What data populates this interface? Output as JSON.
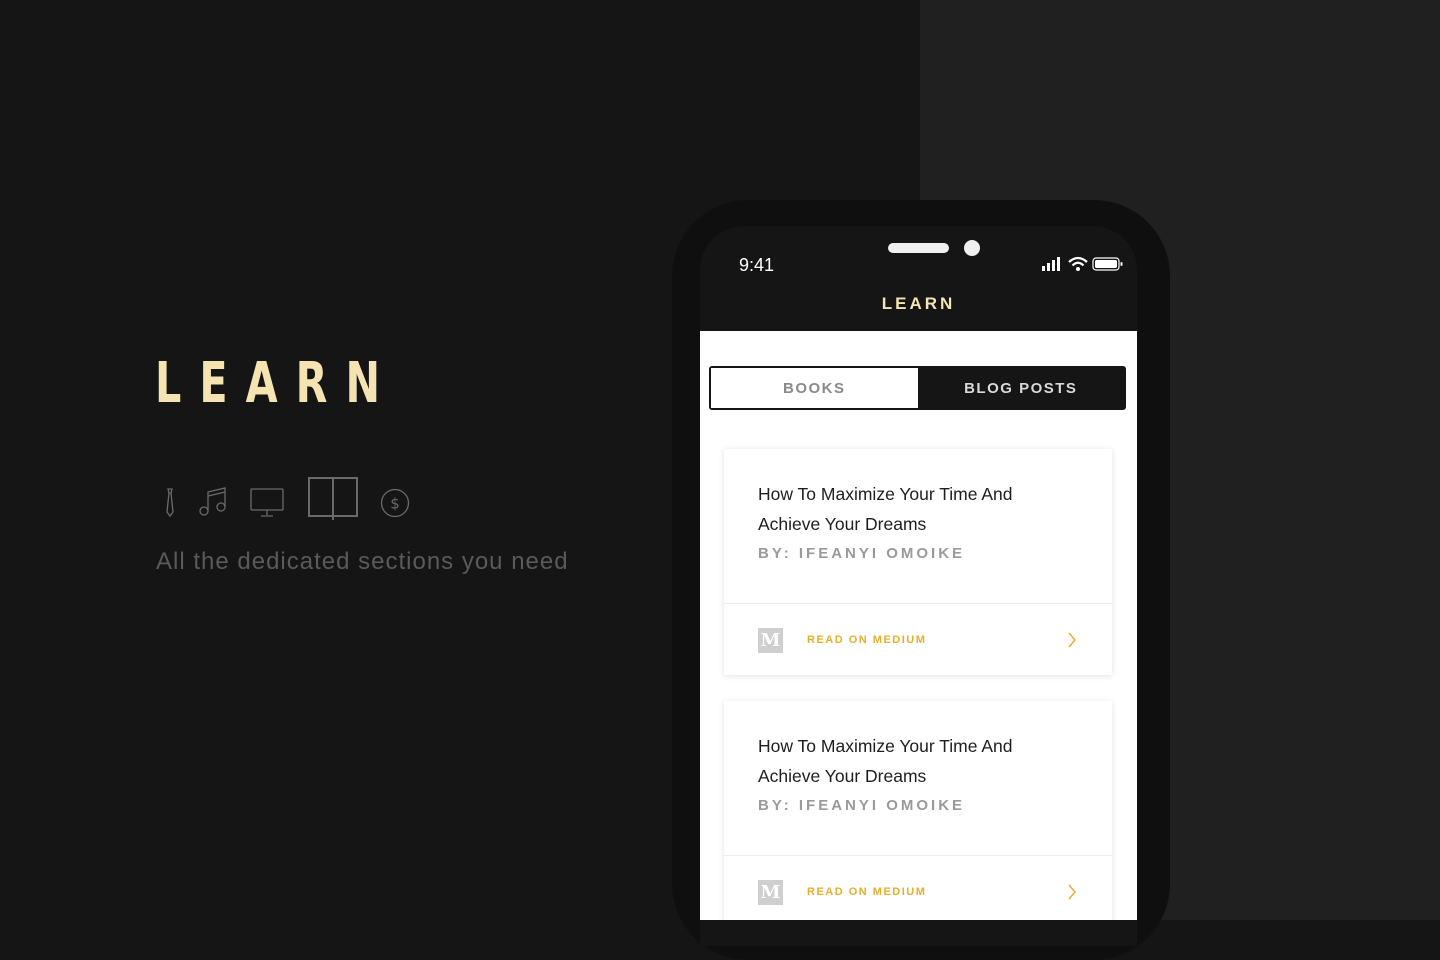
{
  "hero": {
    "title": "LEARN",
    "subtitle": "All the dedicated sections you need",
    "section_icons": [
      "tie-icon",
      "music-note-icon",
      "monitor-icon",
      "book-icon",
      "dollar-icon"
    ]
  },
  "status_bar": {
    "time": "9:41",
    "icons": [
      "signal-icon",
      "wifi-icon",
      "battery-icon"
    ]
  },
  "app": {
    "nav_title": "LEARN",
    "tabs": [
      {
        "label": "BOOKS",
        "active": false
      },
      {
        "label": "BLOG POSTS",
        "active": true
      }
    ],
    "posts": [
      {
        "title": "How To Maximize Your Time And Achieve Your Dreams",
        "author": "BY: IFEANYI OMOIKE",
        "link_label": "READ ON MEDIUM",
        "logo_letter": "M"
      },
      {
        "title": "How To Maximize Your Time And Achieve Your Dreams",
        "author": "BY: IFEANYI OMOIKE",
        "link_label": "READ ON MEDIUM",
        "logo_letter": "M"
      }
    ]
  },
  "colors": {
    "accent_cream": "#F6E3B2",
    "link_gold": "#E3B02C",
    "background": "#151515",
    "icon_gray": "#6a6a6a"
  }
}
